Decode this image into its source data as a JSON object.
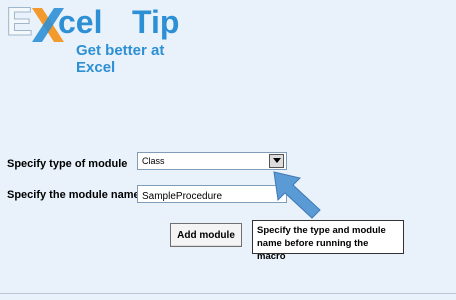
{
  "logo": {
    "brand": "Excel",
    "tip": "Tip",
    "tagline": "Get better at Excel",
    "colors": {
      "primary": "#2d8fd4",
      "accent_x": "#f29a2e"
    }
  },
  "form": {
    "module_type_label": "Specify type of module",
    "module_type_value": "Class",
    "module_name_label": "Specify the module name",
    "module_name_value": "SampleProcedure",
    "add_module_label": "Add module"
  },
  "callout": {
    "text": "Specify the type and module name before running the macro",
    "arrow_color": "#5b9bd5"
  }
}
